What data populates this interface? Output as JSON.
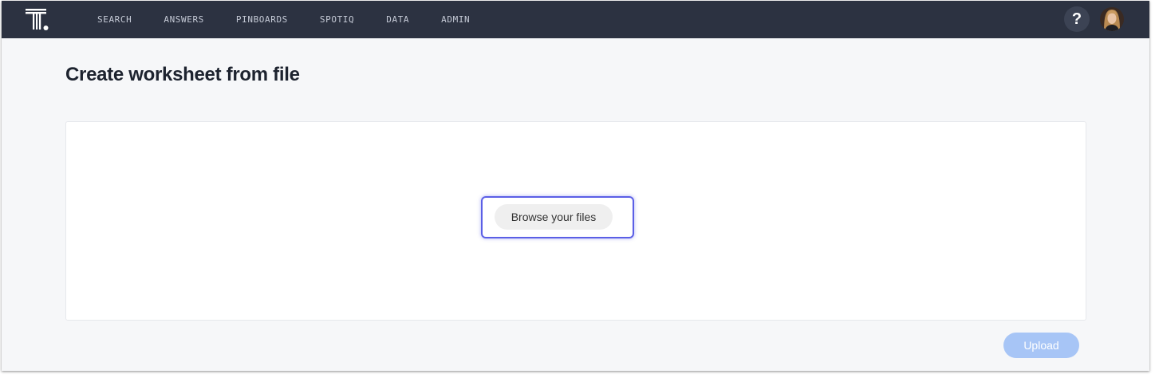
{
  "nav": {
    "items": [
      {
        "label": "SEARCH"
      },
      {
        "label": "ANSWERS"
      },
      {
        "label": "PINBOARDS"
      },
      {
        "label": "SPOTIQ"
      },
      {
        "label": "DATA"
      },
      {
        "label": "ADMIN"
      }
    ],
    "help_label": "?",
    "logo_icon": "thoughtspot-logo-icon",
    "avatar_icon": "user-avatar"
  },
  "page": {
    "title": "Create worksheet from file"
  },
  "drop_panel": {
    "browse_label": "Browse your files"
  },
  "actions": {
    "upload_label": "Upload",
    "upload_enabled": false
  },
  "colors": {
    "topbar": "#2c3241",
    "accent_focus": "#5b5fe6",
    "upload_disabled": "#a7c5f6",
    "page_background": "#f6f7f9"
  }
}
